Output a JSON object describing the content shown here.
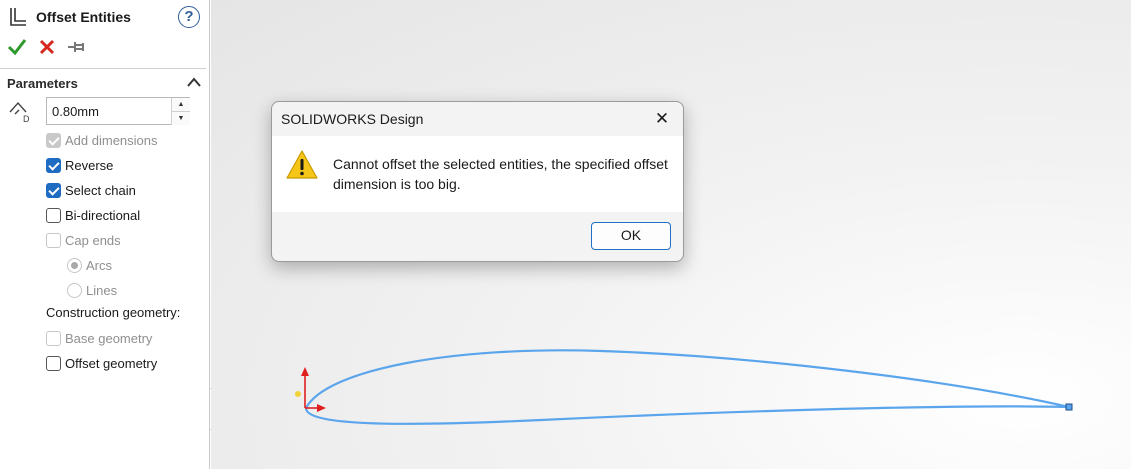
{
  "panel": {
    "title": "Offset Entities",
    "help_glyph": "?",
    "toolbar": {
      "ok": "check-icon",
      "cancel": "close-icon",
      "pin": "pushpin-icon",
      "ok_color": "#2e9a2e",
      "cancel_color": "#d6281e"
    },
    "section_title": "Parameters",
    "distance_value": "0.80mm",
    "distance_icon_letter": "D",
    "options": {
      "add_dimensions": {
        "label": "Add dimensions",
        "checked": true,
        "enabled": false
      },
      "reverse": {
        "label": "Reverse",
        "checked": true,
        "enabled": true
      },
      "select_chain": {
        "label": "Select chain",
        "checked": true,
        "enabled": true
      },
      "bi_directional": {
        "label": "Bi-directional",
        "checked": false,
        "enabled": true
      },
      "cap_ends": {
        "label": "Cap ends",
        "checked": false,
        "enabled": false
      },
      "arcs": {
        "label": "Arcs",
        "selected": true,
        "enabled": false
      },
      "lines": {
        "label": "Lines",
        "selected": false,
        "enabled": false
      }
    },
    "construction_label": "Construction geometry:",
    "construction": {
      "base_geometry": {
        "label": "Base geometry",
        "checked": false,
        "enabled": false
      },
      "offset_geometry": {
        "label": "Offset geometry",
        "checked": false,
        "enabled": true
      }
    }
  },
  "dialog": {
    "title": "SOLIDWORKS Design",
    "close_glyph": "✕",
    "message_line1": "Cannot offset the selected entities, the specified offset",
    "message_line2": "dimension is too big.",
    "ok_label": "OK",
    "icon": "warning-icon"
  },
  "colors": {
    "accent": "#1e6bc2",
    "sketch_curve": "#5aa5ec",
    "axis_red": "#e02020"
  }
}
